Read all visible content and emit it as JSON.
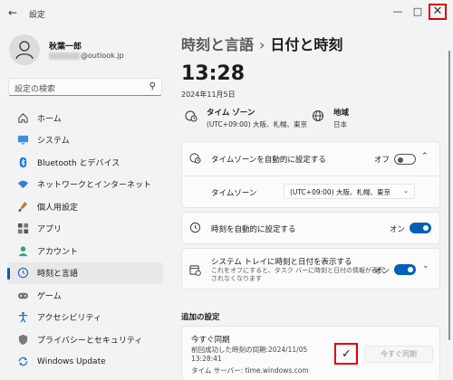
{
  "window": {
    "title": "設定",
    "back_icon": "back-arrow-icon",
    "minimize_icon": "minimize-icon",
    "maximize_icon": "maximize-icon",
    "close_icon": "close-icon",
    "highlight_color": "#e00000"
  },
  "user": {
    "name": "秋葉一郎",
    "email": "@outlook.jp"
  },
  "search": {
    "placeholder": "設定の検索"
  },
  "sidebar": {
    "items": [
      {
        "label": "ホーム",
        "icon": "home-icon"
      },
      {
        "label": "システム",
        "icon": "monitor-icon"
      },
      {
        "label": "Bluetooth とデバイス",
        "icon": "bluetooth-icon"
      },
      {
        "label": "ネットワークとインターネット",
        "icon": "wifi-icon"
      },
      {
        "label": "個人用設定",
        "icon": "paintbrush-icon"
      },
      {
        "label": "アプリ",
        "icon": "apps-icon"
      },
      {
        "label": "アカウント",
        "icon": "account-icon"
      },
      {
        "label": "時刻と言語",
        "icon": "clock-globe-icon",
        "active": true
      },
      {
        "label": "ゲーム",
        "icon": "gamepad-icon"
      },
      {
        "label": "アクセシビリティ",
        "icon": "accessibility-icon"
      },
      {
        "label": "プライバシーとセキュリティ",
        "icon": "shield-icon"
      },
      {
        "label": "Windows Update",
        "icon": "windows-update-icon"
      }
    ]
  },
  "breadcrumb": {
    "parent": "時刻と言語",
    "separator": "›",
    "current": "日付と時刻"
  },
  "clock": {
    "time": "13:28",
    "date": "2024年11月5日"
  },
  "info": {
    "timezone_title": "タイム ゾーン",
    "timezone_value": "(UTC+09:00) 大阪、札幌、東京",
    "region_title": "地域",
    "region_value": "日本"
  },
  "settings": {
    "auto_timezone_label": "タイムゾーンを自動的に設定する",
    "auto_timezone_state": "オフ",
    "timezone_label": "タイムゾーン",
    "timezone_selected": "(UTC+09:00) 大阪、札幌、東京",
    "auto_time_label": "時刻を自動的に設定する",
    "auto_time_state": "オン",
    "tray_label": "システム トレイに時刻と日付を表示する",
    "tray_desc_1": "これをオフにすると、タスク バーに時刻と日付の情報が表示",
    "tray_desc_2": "されなくなります",
    "tray_state": "オン"
  },
  "additional": {
    "title": "追加の設定",
    "sync_title": "今すぐ同期",
    "last_sync": "前回成功した時刻の同期:2024/11/05",
    "last_sync_time": "13:28:41",
    "time_server": "タイム サーバー: time.windows.com",
    "sync_button": "今すぐ同期",
    "check_mark": "✓"
  },
  "colors": {
    "accent": "#005fb8"
  }
}
